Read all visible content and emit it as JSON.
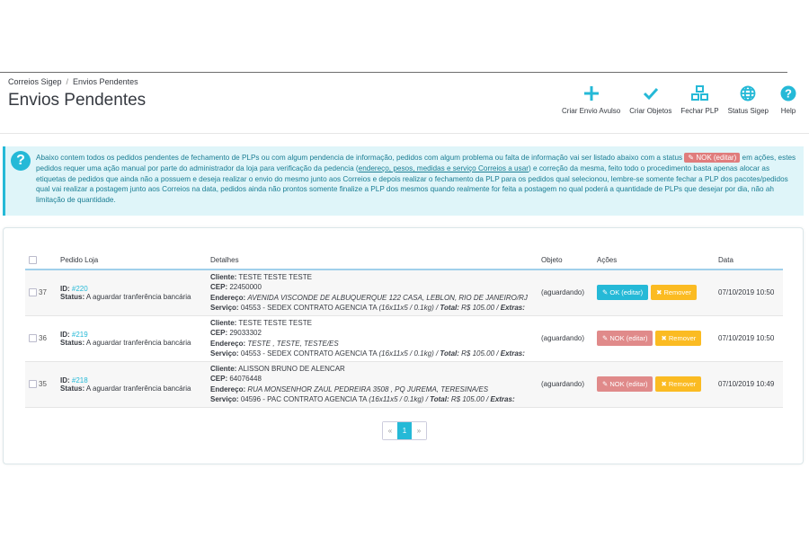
{
  "breadcrumb": {
    "parent": "Correios Sigep",
    "sep": "/",
    "current": "Envios Pendentes"
  },
  "page_title": "Envios Pendentes",
  "toolbar": [
    {
      "label": "Criar Envio Avulso",
      "icon": "plus-icon"
    },
    {
      "label": "Criar Objetos",
      "icon": "check-icon"
    },
    {
      "label": "Fechar PLP",
      "icon": "cubes-icon"
    },
    {
      "label": "Status Sigep",
      "icon": "globe-icon"
    },
    {
      "label": "Help",
      "icon": "question-icon"
    }
  ],
  "alert": {
    "part1": "Abaixo contem todos os pedidos pendentes de fechamento de PLPs ou com algum pendencia de informação, pedidos com algum problema ou falta de informação vai ser listado abaixo com a status",
    "badge": "NOK (editar)",
    "part2": "em ações, estes pedidos requer uma ação manual por parte do administrador da loja para verificação da pedencia (",
    "underline": "endereço, pesos, medidas e serviço Correios a usar",
    "part3": ") e correção da mesma, feito todo o procedimento basta apenas alocar as etiquetas de pedidos que ainda não a possuem e deseja realizar o envio do mesmo junto aos Correios e depois realizar o fechamento da PLP para os pedidos qual selecionou, lembre-se somente fechar a PLP dos pacotes/pedidos qual vai realizar a postagem junto aos Correios na data, pedidos ainda não prontos somente finalize a PLP dos mesmos quando realmente for feita a postagem no qual poderá a quantidade de PLPs que desejar por dia, não ah limitação de quantidade."
  },
  "table": {
    "headers": {
      "pedido": "Pedido Loja",
      "detalhes": "Detalhes",
      "objeto": "Objeto",
      "acoes": "Ações",
      "data": "Data"
    },
    "labels": {
      "id": "ID:",
      "status": "Status:",
      "cliente": "Cliente:",
      "cep": "CEP:",
      "endereco": "Endereço:",
      "servico": "Serviço:",
      "total": "Total:",
      "extras": "Extras:",
      "remover": "Remover"
    },
    "rows": [
      {
        "num": "37",
        "id": "#220",
        "status": "A aguardar tranferência bancária",
        "cliente": "TESTE TESTE TESTE",
        "cep": "22450000",
        "endereco": "AVENIDA VISCONDE DE ALBUQUERQUE 122 CASA, LEBLON, RIO DE JANEIRO/RJ",
        "servico": "04553 - SEDEX CONTRATO AGENCIA TA",
        "dims": "(16x11x5 / 0.1kg) /",
        "total": "R$ 105.00 /",
        "objeto": "(aguardando)",
        "action": "OK (editar)",
        "action_type": "ok",
        "data": "07/10/2019 10:50"
      },
      {
        "num": "36",
        "id": "#219",
        "status": "A aguardar tranferência bancária",
        "cliente": "TESTE TESTE TESTE",
        "cep": "29033302",
        "endereco": "TESTE , TESTE, TESTE/ES",
        "servico": "04553 - SEDEX CONTRATO AGENCIA TA",
        "dims": "(16x11x5 / 0.1kg) /",
        "total": "R$ 105.00 /",
        "objeto": "(aguardando)",
        "action": "NOK (editar)",
        "action_type": "nok",
        "data": "07/10/2019 10:50"
      },
      {
        "num": "35",
        "id": "#218",
        "status": "A aguardar tranferência bancária",
        "cliente": "ALISSON BRUNO DE ALENCAR",
        "cep": "64076448",
        "endereco": "RUA MONSENHOR ZAUL PEDREIRA 3508 , PQ JUREMA, TERESINA/ES",
        "servico": "04596 - PAC CONTRATO AGENCIA TA",
        "dims": "(16x11x5 / 0.1kg) /",
        "total": "R$ 105.00 /",
        "objeto": "(aguardando)",
        "action": "NOK (editar)",
        "action_type": "nok",
        "data": "07/10/2019 10:49"
      }
    ]
  },
  "pagination": {
    "prev": "«",
    "current": "1",
    "next": "»"
  },
  "colors": {
    "accent": "#25b9d7",
    "nok": "#e08a8a",
    "remove": "#fbbb22"
  }
}
